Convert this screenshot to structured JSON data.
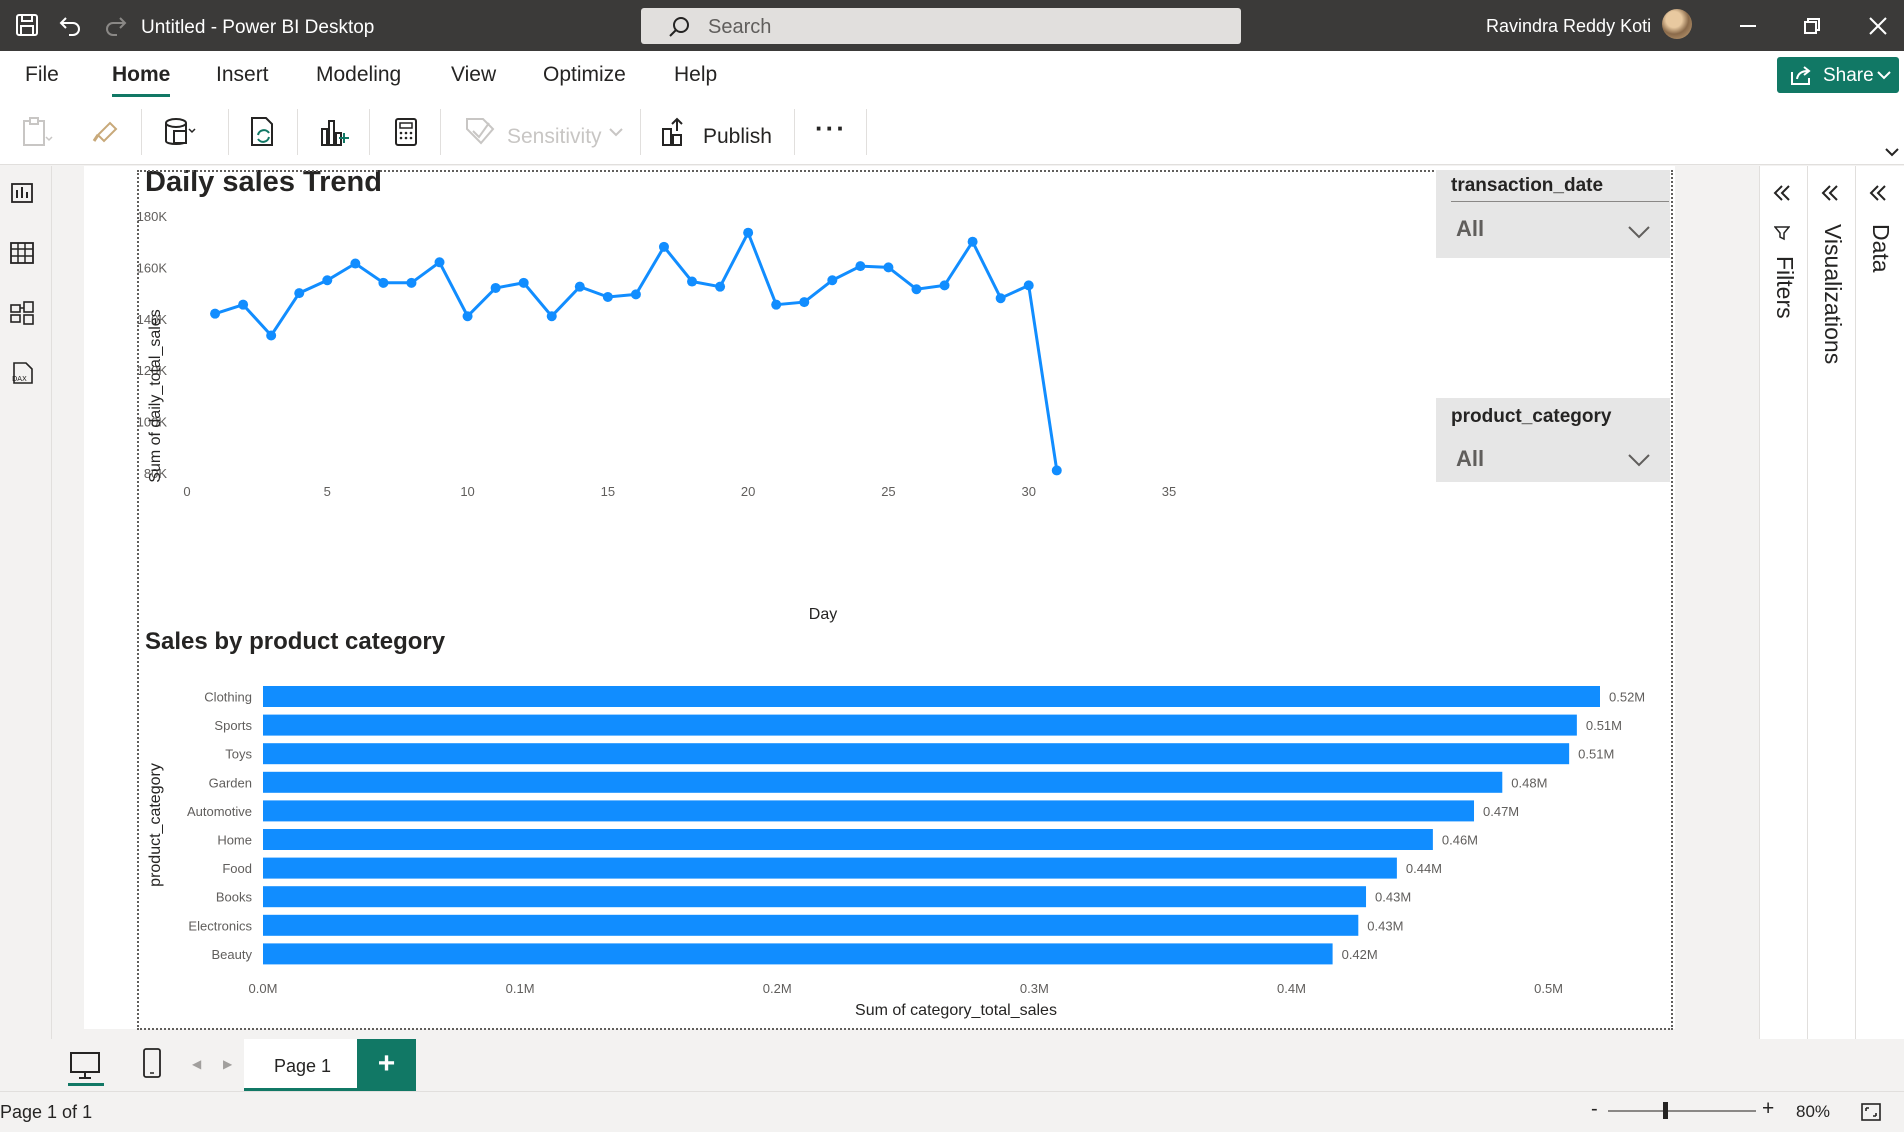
{
  "window": {
    "title": "Untitled - Power BI Desktop",
    "search_placeholder": "Search",
    "user_name": "Ravindra Reddy Koti"
  },
  "ribbon": {
    "tabs": [
      "File",
      "Home",
      "Insert",
      "Modeling",
      "View",
      "Optimize",
      "Help"
    ],
    "active_tab": "Home",
    "share_label": "Share",
    "sensitivity_label": "Sensitivity",
    "publish_label": "Publish",
    "more_label": "···"
  },
  "report": {
    "slicers": [
      {
        "field": "transaction_date",
        "value": "All"
      },
      {
        "field": "product_category",
        "value": "All"
      }
    ]
  },
  "right_panes": [
    "Filters",
    "Visualizations",
    "Data"
  ],
  "pages": {
    "tabs": [
      "Page 1"
    ],
    "add_label": "+",
    "status": "Page 1 of 1"
  },
  "zoom": {
    "minus": "-",
    "plus": "+",
    "level": "80%"
  },
  "colors": {
    "accent": "#117865",
    "series": "#118dff",
    "titlebar": "#3b3a39"
  },
  "chart_data": [
    {
      "type": "line",
      "title": "Daily sales Trend",
      "xlabel": "Day",
      "ylabel": "Sum of daily_total_sales",
      "xlim": [
        0,
        35
      ],
      "ylim": [
        80000,
        180000
      ],
      "xticks": [
        "0",
        "5",
        "10",
        "15",
        "20",
        "25",
        "30",
        "35"
      ],
      "yticks": [
        "80K",
        "100K",
        "120K",
        "140K",
        "160K",
        "180K"
      ],
      "x": [
        1,
        2,
        3,
        4,
        5,
        6,
        7,
        8,
        9,
        10,
        11,
        12,
        13,
        14,
        15,
        16,
        17,
        18,
        19,
        20,
        21,
        22,
        23,
        24,
        25,
        26,
        27,
        28,
        29,
        30,
        31
      ],
      "y": [
        142000,
        145500,
        133500,
        150000,
        155000,
        161500,
        154000,
        154000,
        162000,
        141000,
        152000,
        154000,
        141000,
        152500,
        148500,
        149500,
        168000,
        154500,
        152500,
        173500,
        145500,
        146500,
        155000,
        160500,
        160000,
        151500,
        153000,
        170000,
        148000,
        153000,
        81000
      ],
      "grid": false
    },
    {
      "type": "bar",
      "orientation": "horizontal",
      "title": "Sales by product category",
      "xlabel": "Sum of category_total_sales",
      "ylabel": "product_category",
      "xlim": [
        0,
        0.52
      ],
      "xticks": [
        "0.0M",
        "0.1M",
        "0.2M",
        "0.3M",
        "0.4M",
        "0.5M"
      ],
      "categories": [
        "Clothing",
        "Sports",
        "Toys",
        "Garden",
        "Automotive",
        "Home",
        "Food",
        "Books",
        "Electronics",
        "Beauty"
      ],
      "values": [
        0.52,
        0.511,
        0.508,
        0.482,
        0.471,
        0.455,
        0.441,
        0.429,
        0.426,
        0.416
      ],
      "data_labels": [
        "0.52M",
        "0.51M",
        "0.51M",
        "0.48M",
        "0.47M",
        "0.46M",
        "0.44M",
        "0.43M",
        "0.43M",
        "0.42M"
      ],
      "grid": false
    }
  ]
}
